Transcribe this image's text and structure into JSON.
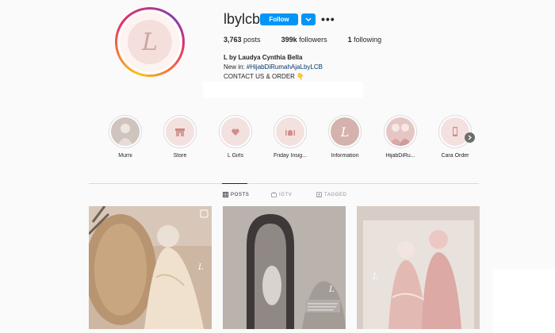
{
  "profile": {
    "username": "lbylcb",
    "follow_label": "Follow",
    "more_label": "•••",
    "avatar_letter": "L",
    "stats": {
      "posts_value": "3,763",
      "posts_label": "posts",
      "followers_value": "399k",
      "followers_label": "followers",
      "following_value": "1",
      "following_label": "following"
    },
    "full_name": "L by Laudya Cynthia Bella",
    "bio_prefix": "New in: ",
    "bio_hashtag": "#HijabDiRumahAjaLbyLCB",
    "bio_line2": "CONTACT US & ORDER 👇"
  },
  "highlights": [
    {
      "label": "Murni",
      "icon": "photo-portrait"
    },
    {
      "label": "Store",
      "icon": "store-icon"
    },
    {
      "label": "L Girls",
      "icon": "heart-icon"
    },
    {
      "label": "Friday Insig...",
      "icon": "mosque-icon"
    },
    {
      "label": "Information",
      "icon": "logo-L"
    },
    {
      "label": "HijabDiRu...",
      "icon": "photo-group"
    },
    {
      "label": "Cara Order",
      "icon": "phone-icon"
    }
  ],
  "tabs": [
    {
      "label": "POSTS",
      "icon": "grid-icon",
      "active": true
    },
    {
      "label": "IGTV",
      "icon": "igtv-icon",
      "active": false
    },
    {
      "label": "TAGGED",
      "icon": "tag-icon",
      "active": false
    }
  ],
  "colors": {
    "accent": "#0095f6",
    "text": "#262626",
    "muted": "#8e8e8e",
    "hashtag": "#00376b"
  }
}
